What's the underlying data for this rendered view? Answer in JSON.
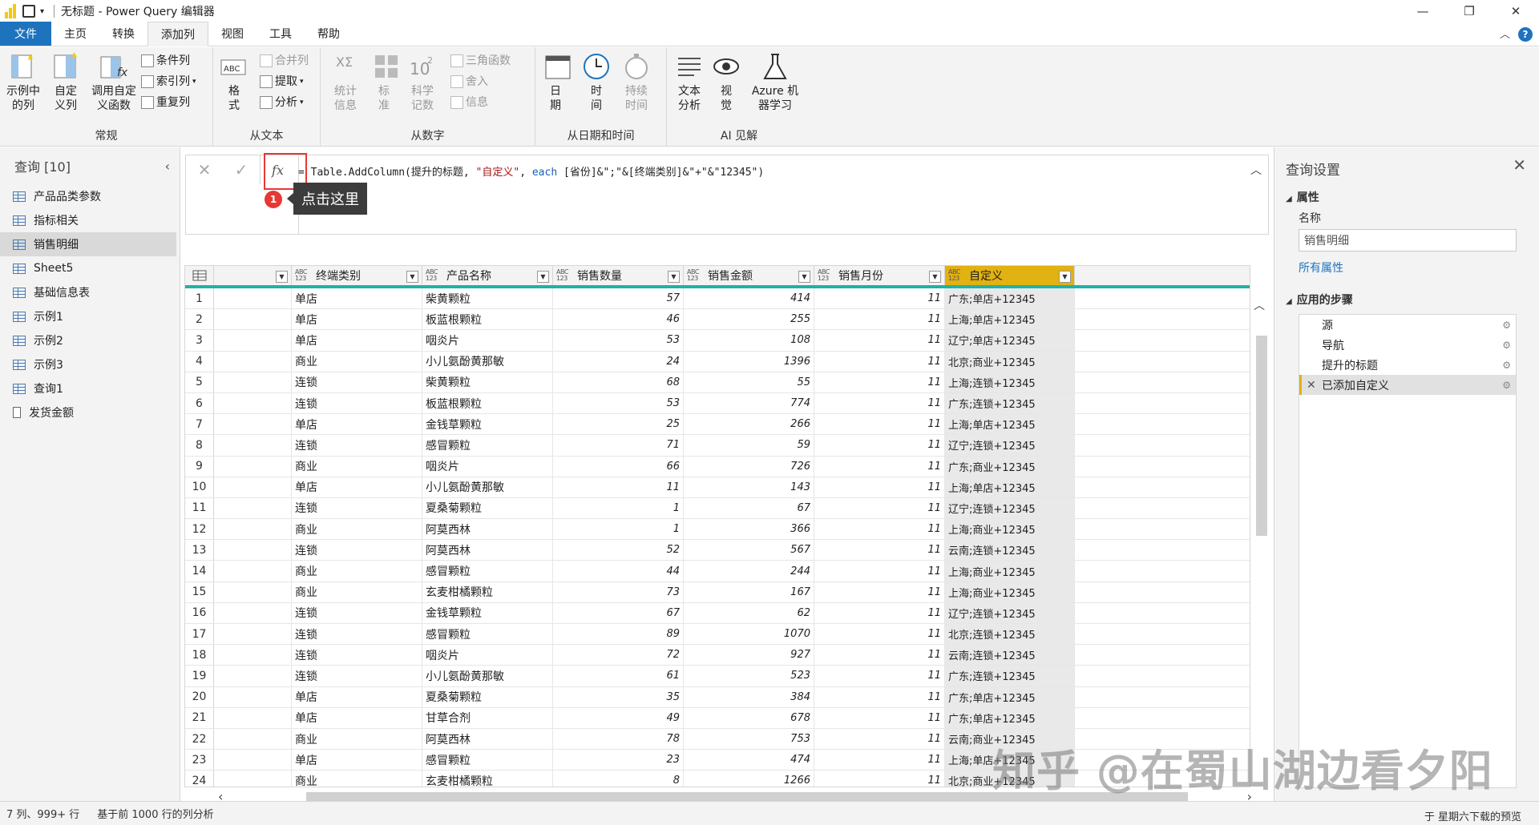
{
  "window": {
    "title": "无标题 - Power Query 编辑器"
  },
  "menu": {
    "file": "文件",
    "tabs": [
      "主页",
      "转换",
      "添加列",
      "视图",
      "工具",
      "帮助"
    ]
  },
  "ribbon": {
    "general": {
      "label": "常规",
      "example_col": "示例中的列",
      "custom_col": "自定义列",
      "invoke_fn": "调用自定义函数",
      "conditional": "条件列",
      "index": "索引列",
      "duplicate": "重复列"
    },
    "text": {
      "label": "从文本",
      "format": "格式",
      "merge": "合并列",
      "extract": "提取",
      "parse": "分析"
    },
    "number": {
      "label": "从数字",
      "stats": "统计信息",
      "standard": "标准",
      "scientific": "科学记数",
      "trig": "三角函数",
      "round": "舍入",
      "info": "信息"
    },
    "datetime": {
      "label": "从日期和时间",
      "date": "日期",
      "time": "时间",
      "duration": "持续时间"
    },
    "ai": {
      "label": "AI 见解",
      "text_analytics": "文本分析",
      "vision": "视觉",
      "azure_ml": "Azure 机器学习"
    }
  },
  "queries": {
    "header": "查询 [10]",
    "items": [
      "产品品类参数",
      "指标相关",
      "销售明细",
      "Sheet5",
      "基础信息表",
      "示例1",
      "示例2",
      "示例3",
      "查询1",
      "发货金额"
    ],
    "selected": "销售明细"
  },
  "formula": {
    "eq": "=",
    "prefix": "Table.AddColumn(提升的标题, ",
    "str1": "\"自定义\"",
    "mid": ", ",
    "each": "each",
    "rest": " [省份]&\";\"&[终端类别]&\"+\"&\"12345\")"
  },
  "callout": {
    "badge": "1",
    "text": "点击这里"
  },
  "table": {
    "type_badge": "ABC 123",
    "columns": [
      "终端类别",
      "产品名称",
      "销售数量",
      "销售金额",
      "销售月份",
      "自定义"
    ],
    "rows": [
      [
        "单店",
        "柴黄颗粒",
        "57",
        "414",
        "11",
        "广东;单店+12345"
      ],
      [
        "单店",
        "板蓝根颗粒",
        "46",
        "255",
        "11",
        "上海;单店+12345"
      ],
      [
        "单店",
        "咽炎片",
        "53",
        "108",
        "11",
        "辽宁;单店+12345"
      ],
      [
        "商业",
        "小儿氨酚黄那敏",
        "24",
        "1396",
        "11",
        "北京;商业+12345"
      ],
      [
        "连锁",
        "柴黄颗粒",
        "68",
        "55",
        "11",
        "上海;连锁+12345"
      ],
      [
        "连锁",
        "板蓝根颗粒",
        "53",
        "774",
        "11",
        "广东;连锁+12345"
      ],
      [
        "单店",
        "金钱草颗粒",
        "25",
        "266",
        "11",
        "上海;单店+12345"
      ],
      [
        "连锁",
        "感冒颗粒",
        "71",
        "59",
        "11",
        "辽宁;连锁+12345"
      ],
      [
        "商业",
        "咽炎片",
        "66",
        "726",
        "11",
        "广东;商业+12345"
      ],
      [
        "单店",
        "小儿氨酚黄那敏",
        "11",
        "143",
        "11",
        "上海;单店+12345"
      ],
      [
        "连锁",
        "夏桑菊颗粒",
        "1",
        "67",
        "11",
        "辽宁;连锁+12345"
      ],
      [
        "商业",
        "阿莫西林",
        "1",
        "366",
        "11",
        "上海;商业+12345"
      ],
      [
        "连锁",
        "阿莫西林",
        "52",
        "567",
        "11",
        "云南;连锁+12345"
      ],
      [
        "商业",
        "感冒颗粒",
        "44",
        "244",
        "11",
        "上海;商业+12345"
      ],
      [
        "商业",
        "玄麦柑橘颗粒",
        "73",
        "167",
        "11",
        "上海;商业+12345"
      ],
      [
        "连锁",
        "金钱草颗粒",
        "67",
        "62",
        "11",
        "辽宁;连锁+12345"
      ],
      [
        "连锁",
        "感冒颗粒",
        "89",
        "1070",
        "11",
        "北京;连锁+12345"
      ],
      [
        "连锁",
        "咽炎片",
        "72",
        "927",
        "11",
        "云南;连锁+12345"
      ],
      [
        "连锁",
        "小儿氨酚黄那敏",
        "61",
        "523",
        "11",
        "广东;连锁+12345"
      ],
      [
        "单店",
        "夏桑菊颗粒",
        "35",
        "384",
        "11",
        "广东;单店+12345"
      ],
      [
        "单店",
        "甘草合剂",
        "49",
        "678",
        "11",
        "广东;单店+12345"
      ],
      [
        "商业",
        "阿莫西林",
        "78",
        "753",
        "11",
        "云南;商业+12345"
      ],
      [
        "单店",
        "感冒颗粒",
        "23",
        "474",
        "11",
        "上海;单店+12345"
      ],
      [
        "商业",
        "玄麦柑橘颗粒",
        "8",
        "1266",
        "11",
        "北京;商业+12345"
      ]
    ]
  },
  "settings": {
    "title": "查询设置",
    "properties": "属性",
    "name_label": "名称",
    "name_value": "销售明细",
    "all_props": "所有属性",
    "steps_label": "应用的步骤",
    "steps": [
      "源",
      "导航",
      "提升的标题",
      "已添加自定义"
    ]
  },
  "status": {
    "cols": "7 列、999+ 行",
    "profile": "基于前 1000 行的列分析",
    "right": "于 星期六下载的预览"
  },
  "watermark": "知乎 @在蜀山湖边看夕阳"
}
